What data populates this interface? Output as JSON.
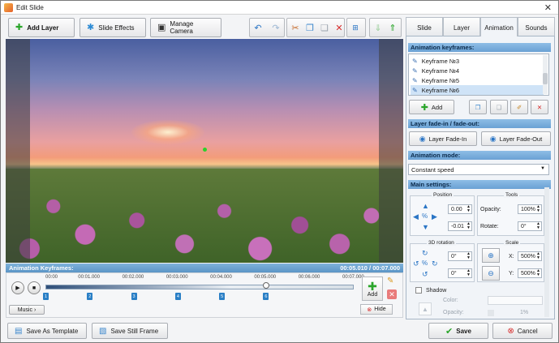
{
  "window": {
    "title": "Edit Slide",
    "close_glyph": "✕"
  },
  "toolbar": {
    "add_layer": "Add Layer",
    "slide_effects": "Slide Effects",
    "manage_camera": "Manage Camera"
  },
  "keyframes_bar": {
    "label": "Animation Keyframes:",
    "time": "00:05.010 / 00:07.000"
  },
  "timeline": {
    "ticks": [
      "00:00",
      "00:01.000",
      "00:02.000",
      "00:03.000",
      "00:04.000",
      "00:05.000",
      "00:06.000",
      "00:07.000"
    ],
    "markers": [
      "1",
      "2",
      "3",
      "4",
      "5",
      "6"
    ],
    "playhead_position_seconds": 5.01,
    "music_label": "Music",
    "add_label": "Add",
    "hide_label": "Hide"
  },
  "bottom": {
    "save_template": "Save As Template",
    "save_still": "Save Still Frame",
    "save": "Save",
    "cancel": "Cancel"
  },
  "tabs": [
    "Slide",
    "Layer",
    "Animation",
    "Sounds"
  ],
  "active_tab": "Animation",
  "animation_keyframes": {
    "header": "Animation keyframes:",
    "items": [
      "Keyframe №3",
      "Keyframe №4",
      "Keyframe №5",
      "Keyframe №6"
    ],
    "selected": "Keyframe №6",
    "add_label": "Add"
  },
  "fade": {
    "header": "Layer fade-in / fade-out:",
    "fade_in": "Layer Fade-In",
    "fade_out": "Layer Fade-Out"
  },
  "mode": {
    "header": "Animation mode:",
    "value": "Constant speed"
  },
  "main_settings": {
    "header": "Main settings:",
    "position_label": "Position",
    "tools_label": "Tools",
    "pos_x": "0.00",
    "pos_y": "-0.01",
    "opacity_label": "Opacity:",
    "opacity_value": "100%",
    "rotate_label": "Rotate:",
    "rotate_value": "0°",
    "rotation3d_label": "3D rotation",
    "rot_a": "0°",
    "rot_b": "0°",
    "scale_label": "Scale",
    "scale_x_label": "X:",
    "scale_x": "500%",
    "scale_y_label": "Y:",
    "scale_y": "500%",
    "shadow_label": "Shadow",
    "color_label": "Color:",
    "shadow_opacity_label": "Opacity:",
    "shadow_opacity_value": "1%"
  }
}
